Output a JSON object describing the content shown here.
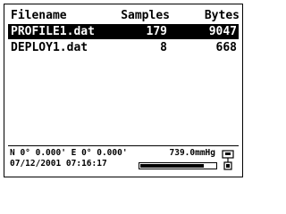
{
  "table": {
    "headers": {
      "filename": "Filename",
      "samples": "Samples",
      "bytes": "Bytes"
    },
    "rows": [
      {
        "filename": "PROFILE1.dat",
        "samples": "179",
        "bytes": "9047",
        "selected": true
      },
      {
        "filename": "DEPLOY1.dat",
        "samples": "8",
        "bytes": "668",
        "selected": false
      }
    ]
  },
  "status": {
    "gps": "N 0° 0.000' E 0° 0.000'",
    "datetime": "07/12/2001 07:16:17",
    "pressure": "739.0mmHg",
    "battery_level_percent": 85
  },
  "icons": {
    "battery": "battery-icon",
    "device": "probe-icon"
  },
  "colors": {
    "selection_bg": "#000000",
    "selection_fg": "#ffffff",
    "text": "#000000",
    "background": "#ffffff"
  }
}
